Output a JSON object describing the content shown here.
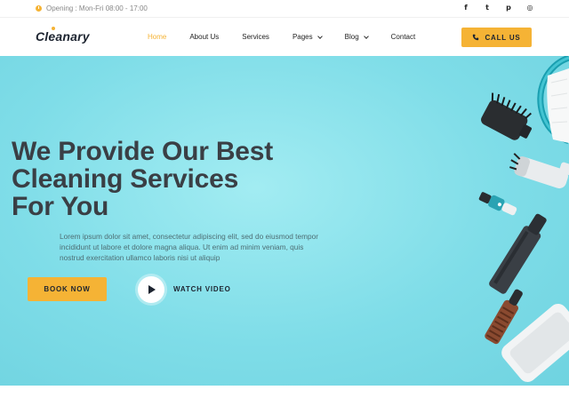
{
  "topbar": {
    "hours": "Opening : Mon-Fri 08:00 - 17:00",
    "social": [
      {
        "icon": "facebook-icon",
        "glyph": "f"
      },
      {
        "icon": "twitter-icon",
        "glyph": "t"
      },
      {
        "icon": "pinterest-icon",
        "glyph": "p"
      },
      {
        "icon": "instagram-icon",
        "glyph": "◎"
      }
    ]
  },
  "nav": {
    "logo": "Cleanary",
    "items": [
      {
        "label": "Home",
        "active": true
      },
      {
        "label": "About Us"
      },
      {
        "label": "Services"
      },
      {
        "label": "Pages",
        "dropdown": true
      },
      {
        "label": "Blog",
        "dropdown": true
      },
      {
        "label": "Contact"
      }
    ],
    "call_label": "CALL US"
  },
  "hero": {
    "headline": [
      "We Provide Our Best",
      "Cleaning Services",
      "For You"
    ],
    "description": "Lorem ipsum dolor sit amet, consectetur adipiscing elit, sed do eiusmod tempor incididunt ut labore et dolore magna aliqua. Ut enim ad minim veniam, quis nostrud exercitation ullamco laboris nisi ut aliquip",
    "book_label": "BOOK NOW",
    "watch_label": "WATCH VIDEO"
  },
  "colors": {
    "accent": "#f5b335",
    "hero_bg": "#8fe3ec",
    "dark": "#1d2430"
  }
}
